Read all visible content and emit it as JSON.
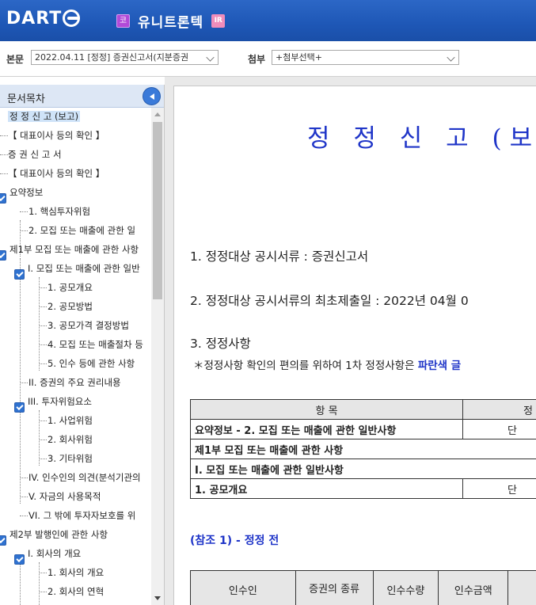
{
  "header": {
    "logo": "DART",
    "company_badge": "코",
    "company_name": "유니트론텍",
    "ir_badge": "IR"
  },
  "selectors": {
    "main_label": "본문",
    "main_value": "2022.04.11 [정정] 증권신고서(지분증권",
    "attach_label": "첨부",
    "attach_value": "+첨부선택+"
  },
  "toc": {
    "title": "문서목차",
    "items": [
      {
        "label": "정 정 신 고 (보고)"
      },
      {
        "label": "【 대표이사 등의 확인 】"
      },
      {
        "label": "증 권 신 고 서"
      },
      {
        "label": "【 대표이사 등의 확인 】"
      },
      {
        "label": "요약정보"
      },
      {
        "label": "1. 핵심투자위험"
      },
      {
        "label": "2. 모집 또는 매출에 관한 일"
      },
      {
        "label": "제1부 모집 또는 매출에 관한 사항"
      },
      {
        "label": "I. 모집 또는 매출에 관한 일반"
      },
      {
        "label": "1. 공모개요"
      },
      {
        "label": "2. 공모방법"
      },
      {
        "label": "3. 공모가격 결정방법"
      },
      {
        "label": "4. 모집 또는 매출절차 등"
      },
      {
        "label": "5. 인수 등에 관한 사항"
      },
      {
        "label": "II. 증권의 주요 권리내용"
      },
      {
        "label": "III. 투자위험요소"
      },
      {
        "label": "1. 사업위험"
      },
      {
        "label": "2. 회사위험"
      },
      {
        "label": "3. 기타위험"
      },
      {
        "label": "IV. 인수인의 의견(분석기관의"
      },
      {
        "label": "V. 자금의 사용목적"
      },
      {
        "label": "VI. 그 밖에 투자자보호를 위"
      },
      {
        "label": "제2부 발행인에 관한 사항"
      },
      {
        "label": "I. 회사의 개요"
      },
      {
        "label": "1. 회사의 개요"
      },
      {
        "label": "2. 회사의 연혁"
      }
    ]
  },
  "document": {
    "title": "정 정 신 고 (보고",
    "line1": "1. 정정대상 공시서류 : 증권신고서",
    "line2": "2. 정정대상 공시서류의 최초제출일 : 2022년 04월 0",
    "line3": "3. 정정사항",
    "note_prefix": "＊정정사항 확인의 편의를 위하여 1차 정정사항은 ",
    "note_blue": "파란색 글",
    "table1": {
      "header": [
        "항 목",
        "정"
      ],
      "rows": [
        [
          "요약정보 - 2. 모집 또는 매출에 관한 일반사항",
          "단"
        ],
        [
          "제1부 모집 또는 매출에 관한 사항",
          ""
        ],
        [
          "I. 모집 또는 매출에 관한 일반사항",
          ""
        ],
        [
          "1. 공모개요",
          "단"
        ]
      ]
    },
    "ref_label": "(참조 1) - 정정 전",
    "table2_headers": [
      "인수인",
      "증권의 종류",
      "인수수량",
      "인수금액",
      ""
    ]
  },
  "colors": {
    "header_blue": "#1e57b6",
    "title_blue": "#1f35c8",
    "toc_selected": "#cfe3f8"
  }
}
